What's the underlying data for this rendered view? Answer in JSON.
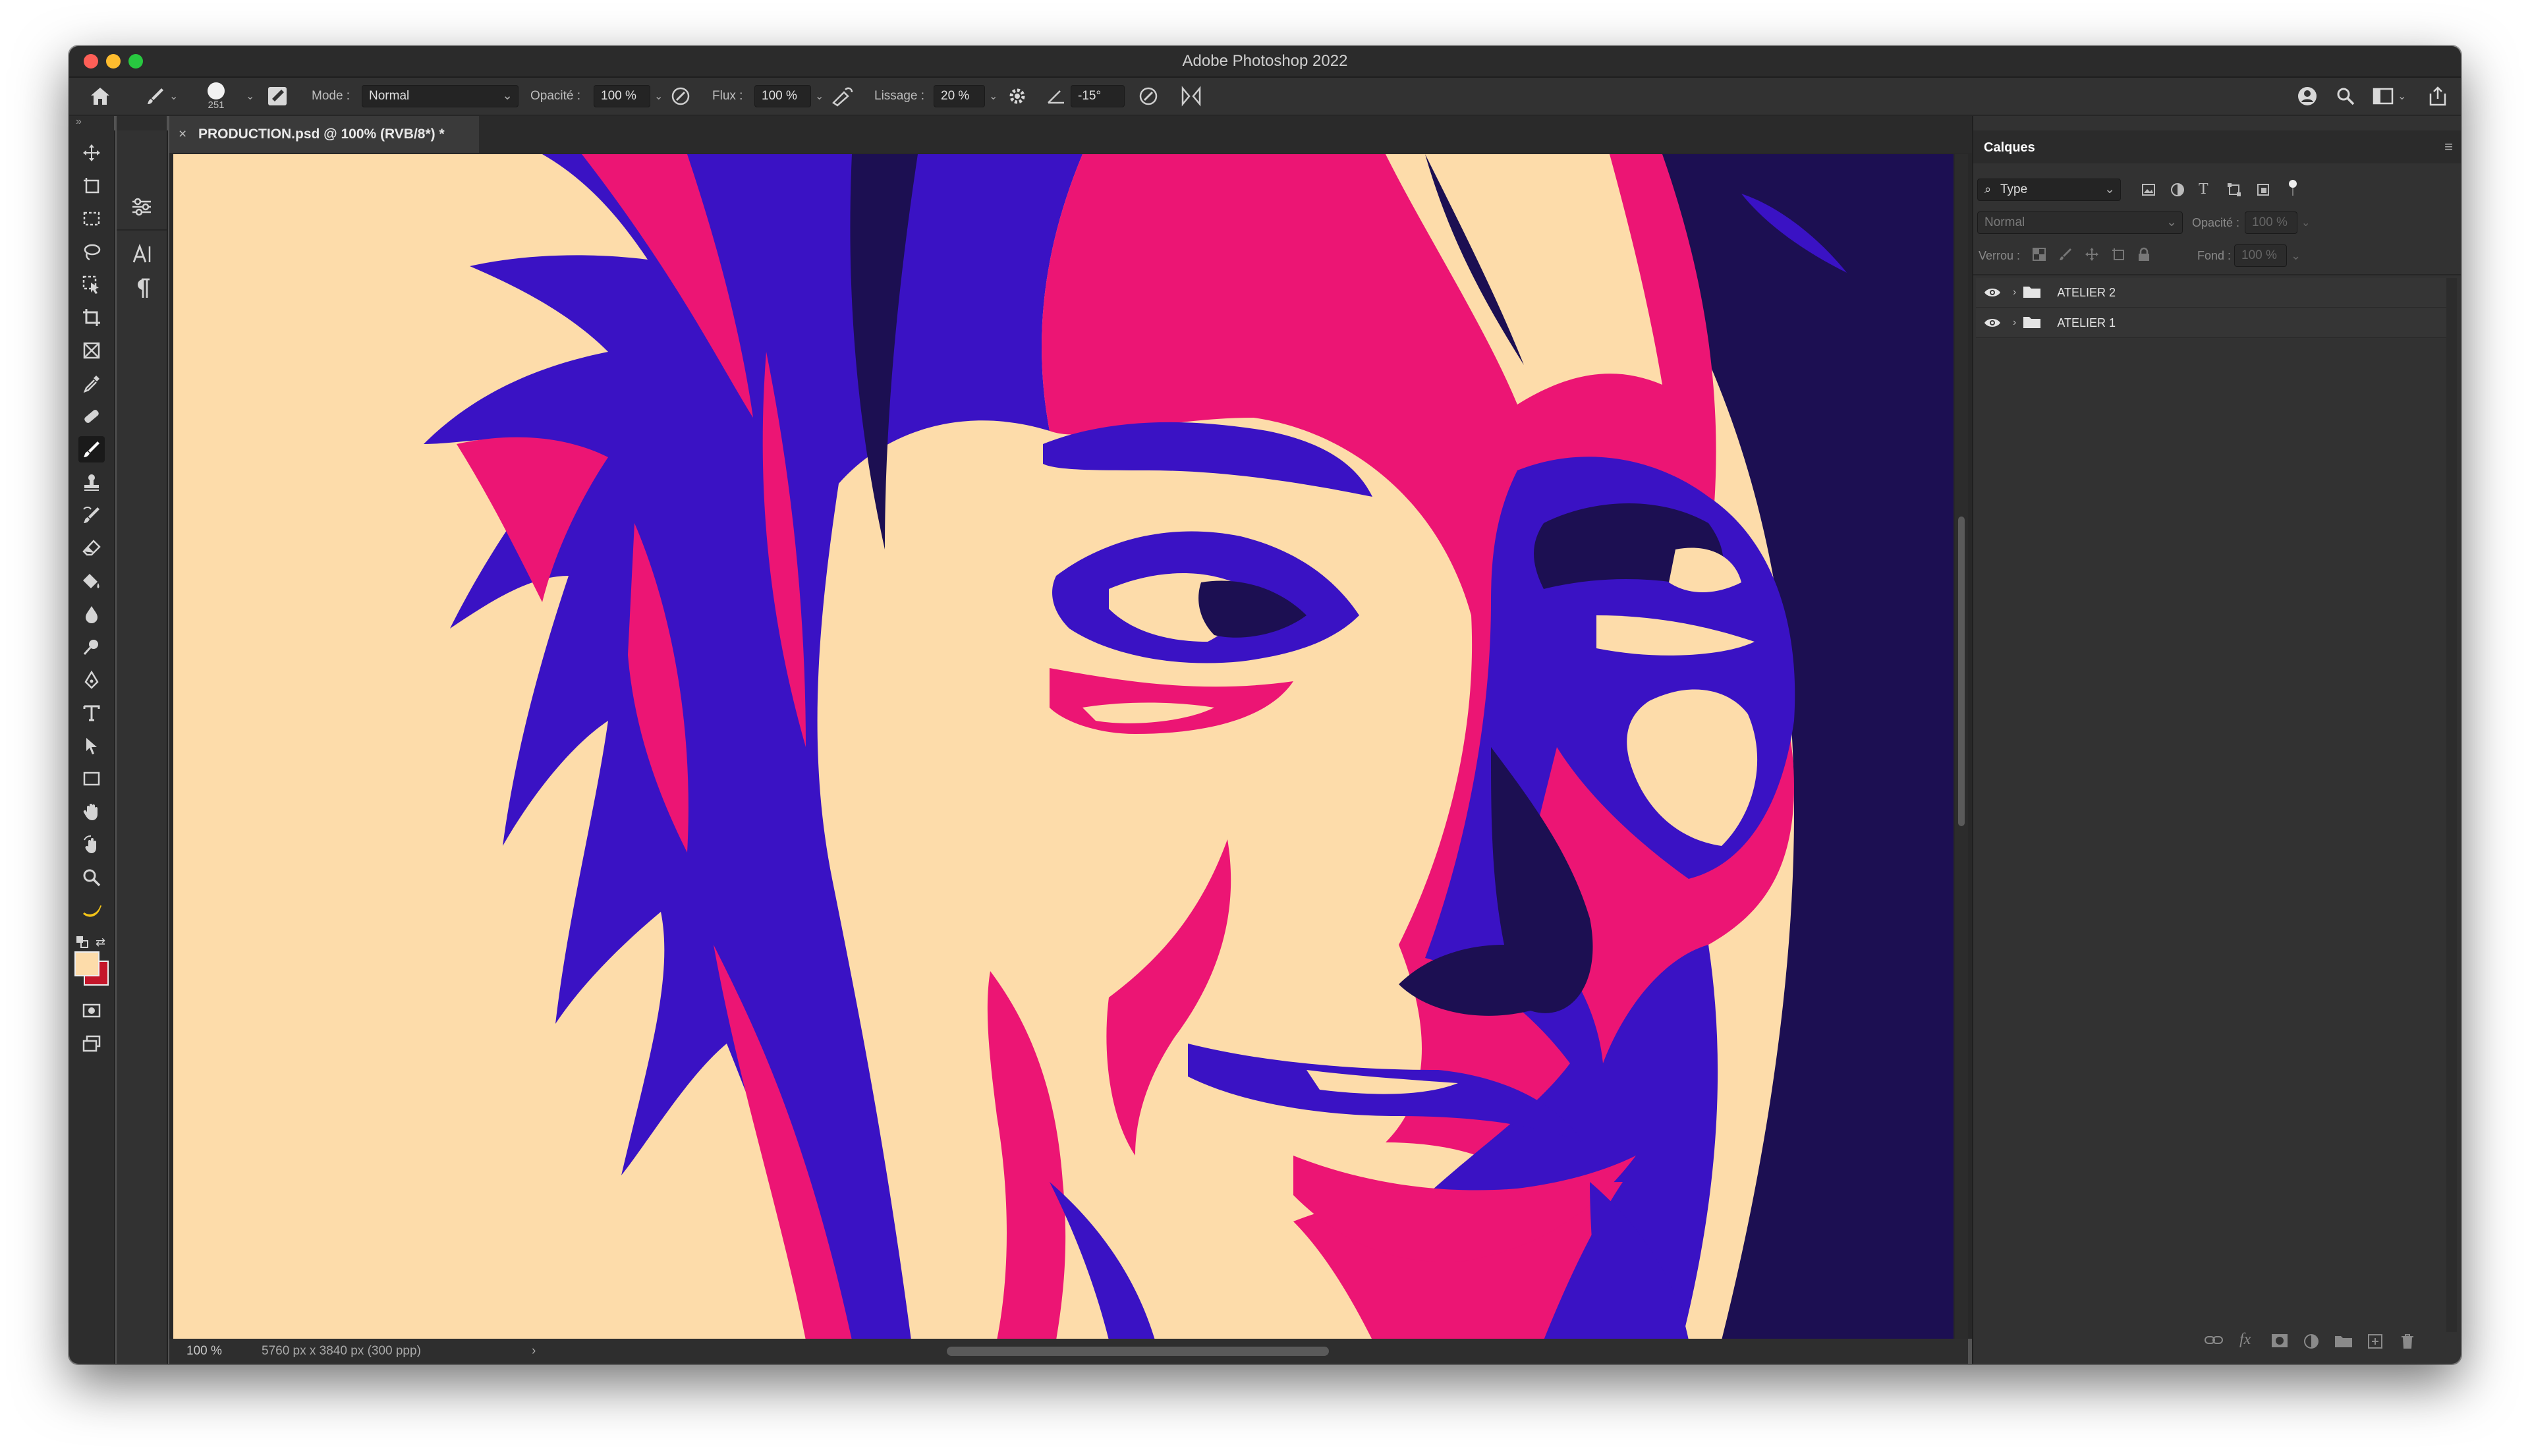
{
  "window": {
    "title": "Adobe Photoshop 2022"
  },
  "options_bar": {
    "brush_size": "251",
    "mode_label": "Mode :",
    "mode_value": "Normal",
    "opacity_label": "Opacité :",
    "opacity_value": "100 %",
    "flow_label": "Flux :",
    "flow_value": "100 %",
    "smoothing_label": "Lissage :",
    "smoothing_value": "20 %",
    "angle_value": "-15°"
  },
  "document": {
    "tab_title": "PRODUCTION.psd @ 100% (RVB/8*) *"
  },
  "status_bar": {
    "zoom": "100 %",
    "doc_info": "5760 px x 3840 px (300 ppp)"
  },
  "layers_panel": {
    "title": "Calques",
    "filter_value": "Type",
    "blend_value": "Normal",
    "opacity_label": "Opacité :",
    "opacity_value": "100 %",
    "lock_label": "Verrou :",
    "fill_label": "Fond :",
    "fill_value": "100 %",
    "layers": [
      {
        "name": "ATELIER 2"
      },
      {
        "name": "ATELIER 1"
      }
    ]
  },
  "colors": {
    "foreground": "#fddcaa",
    "background": "#c4162a",
    "art_peach": "#fddcaa",
    "art_pink": "#ec1574",
    "art_blue": "#3a12c4",
    "art_navy": "#1c0f52"
  }
}
